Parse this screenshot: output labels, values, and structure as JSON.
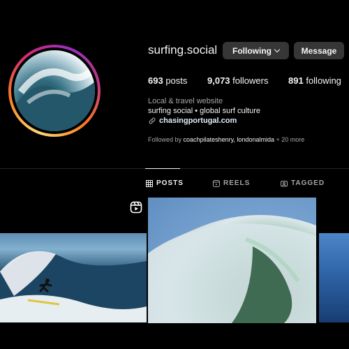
{
  "profile": {
    "username": "surfing.social",
    "following_button": "Following",
    "message_button": "Message",
    "stats": {
      "posts_count": "693",
      "posts_label": "posts",
      "followers_count": "9,073",
      "followers_label": "followers",
      "following_count": "891",
      "following_label": "following"
    },
    "bio": {
      "category": "Local & travel website",
      "text": "surfing social • global surf culture",
      "link": "chasingportugal.com"
    },
    "followed_by": {
      "prefix": "Followed by",
      "names": "coachpilateshenry, londonalmida",
      "suffix": "+ 20 more"
    }
  },
  "tabs": [
    {
      "label": "POSTS",
      "icon": "grid-icon",
      "active": true
    },
    {
      "label": "REELS",
      "icon": "reels-icon",
      "active": false
    },
    {
      "label": "TAGGED",
      "icon": "tagged-icon",
      "active": false
    }
  ],
  "icons": {
    "reel_badge": "reel-icon",
    "link": "link-icon"
  },
  "colors": {
    "background": "#000000",
    "button": "#363636",
    "secondary_text": "#a8a8a8",
    "link_text": "#e0f1ff",
    "ring_gradient": [
      "#feda75",
      "#fa7e1e",
      "#d62976",
      "#962fbf"
    ]
  }
}
